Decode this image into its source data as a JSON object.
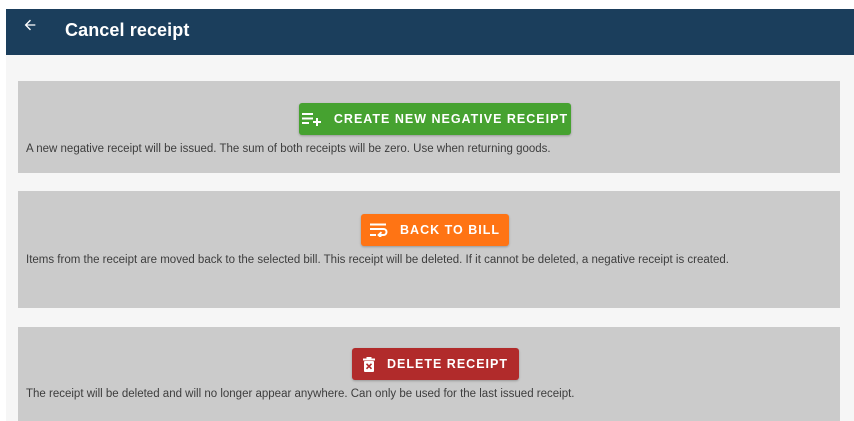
{
  "header": {
    "title": "Cancel receipt",
    "back_icon": "arrow-back-icon",
    "background": "#1b3e5c"
  },
  "options": [
    {
      "button_label": "CREATE NEW NEGATIVE RECEIPT",
      "icon": "list-add-icon",
      "color": "#46a230",
      "description": "A new negative receipt will be issued. The sum of both receipts will be zero. Use when returning goods."
    },
    {
      "button_label": "BACK TO BILL",
      "icon": "wrap-text-icon",
      "color": "#ff7414",
      "description": "Items from the receipt are moved back to the selected bill. This receipt will be deleted. If it cannot be deleted, a negative receipt is created."
    },
    {
      "button_label": "DELETE RECEIPT",
      "icon": "delete-forever-icon",
      "color": "#b12b2b",
      "description": "The receipt will be deleted and will no longer appear anywhere. Can only be used for the last issued receipt."
    }
  ]
}
